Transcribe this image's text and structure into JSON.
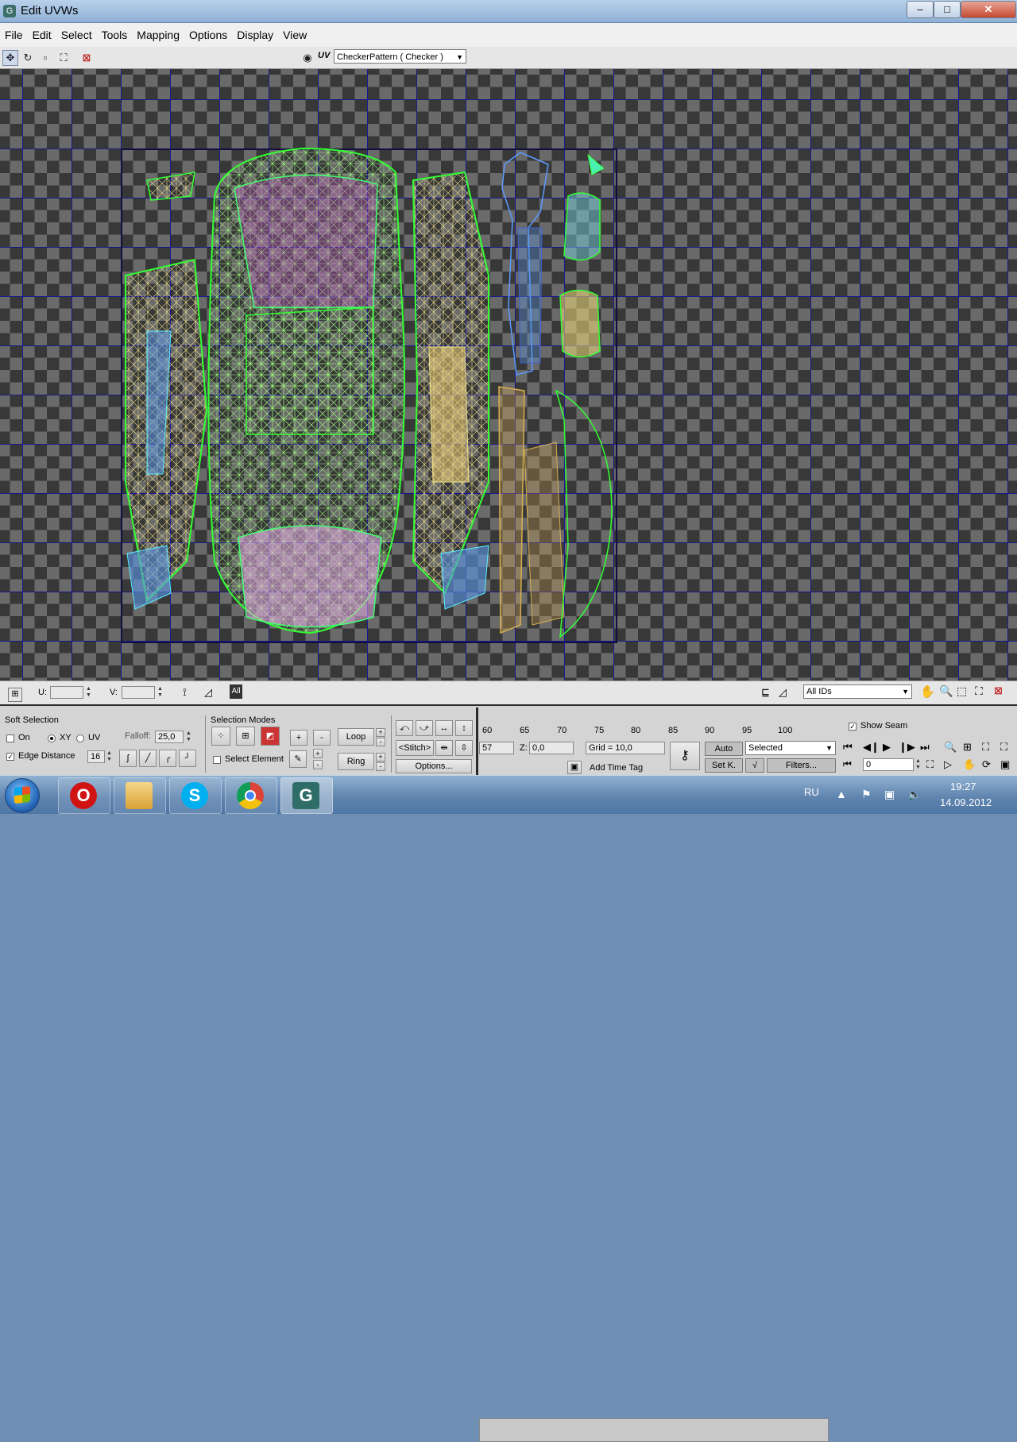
{
  "window": {
    "title": "Edit UVWs",
    "minimize": "–",
    "maximize": "□",
    "close": "✕"
  },
  "menu": [
    "File",
    "Edit",
    "Select",
    "Tools",
    "Mapping",
    "Options",
    "Display",
    "View"
  ],
  "toolbar": {
    "uv_label": "UV",
    "texture_select": "CheckerPattern  ( Checker )"
  },
  "viewport_status": {
    "u_label": "U:",
    "u_value": "",
    "v_label": "V:",
    "v_value": "",
    "all_label": "All",
    "ids_select": "All IDs"
  },
  "soft_selection": {
    "title": "Soft Selection",
    "on_label": "On",
    "on_checked": false,
    "xy_label": "XY",
    "xy_selected": true,
    "uv_label": "UV",
    "falloff_label": "Falloff:",
    "falloff_value": "25,0",
    "edge_distance_label": "Edge Distance",
    "edge_distance_checked": true,
    "edge_distance_value": "16"
  },
  "selection_modes": {
    "title": "Selection Modes",
    "select_element_label": "Select Element",
    "plus": "+",
    "minus": "-",
    "loop": "Loop",
    "ring": "Ring"
  },
  "tools_group": {
    "stitch": "Stitch",
    "options": "Options..."
  },
  "timeline": {
    "ticks": [
      "60",
      "65",
      "70",
      "75",
      "80",
      "85",
      "90",
      "95",
      "100"
    ]
  },
  "status_row": {
    "field_57": "57",
    "z_label": "Z:",
    "z_value": "0,0",
    "grid": "Grid = 10,0",
    "add_time_tag": "Add Time Tag",
    "show_seam": "Show Seam",
    "show_seam_checked": true
  },
  "anim_controls": {
    "auto": "Auto",
    "set_k": "Set K.",
    "selected": "Selected",
    "filters": "Filters...",
    "frame": "0"
  },
  "taskbar": {
    "apps": [
      "Windows Explorer",
      "Opera",
      "Skype",
      "Chrome",
      "3ds Max"
    ],
    "lang": "RU",
    "time": "19:27",
    "date": "14.09.2012"
  }
}
